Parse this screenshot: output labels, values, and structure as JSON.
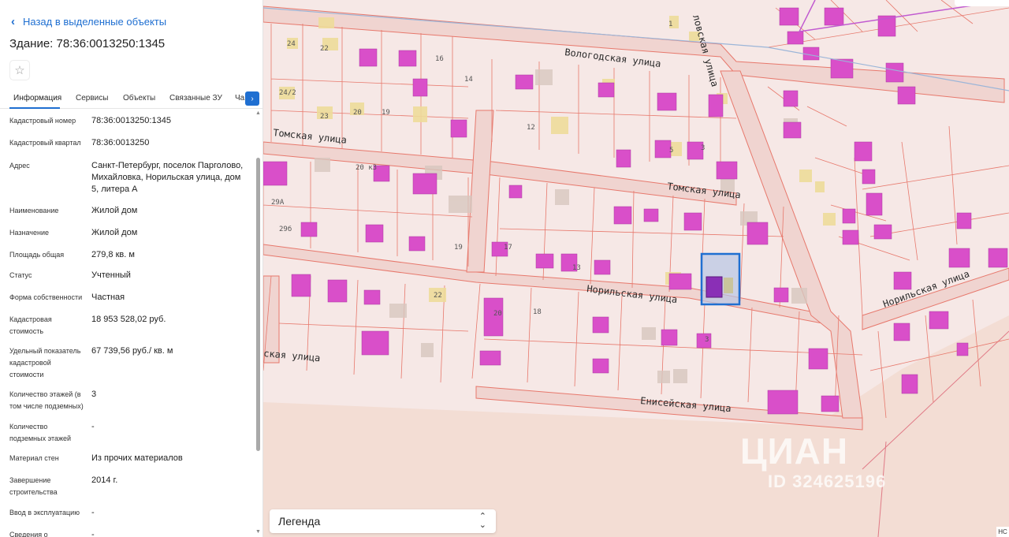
{
  "panel": {
    "back_label": "Назад в выделенные объекты",
    "title": "Здание: 78:36:0013250:1345",
    "tabs": [
      "Информация",
      "Сервисы",
      "Объекты",
      "Связанные ЗУ",
      "Ча"
    ],
    "properties": [
      {
        "label": "Кадастровый номер",
        "value": "78:36:0013250:1345"
      },
      {
        "label": "Кадастровый квартал",
        "value": "78:36:0013250"
      },
      {
        "label": "Адрес",
        "value": "Санкт-Петербург, поселок Парголово, Михайловка, Норильская улица, дом 5, литера А"
      },
      {
        "label": "Наименование",
        "value": "Жилой дом"
      },
      {
        "label": "Назначение",
        "value": "Жилой дом"
      },
      {
        "label": "Площадь общая",
        "value": "279,8 кв. м"
      },
      {
        "label": "Статус",
        "value": "Учтенный"
      },
      {
        "label": "Форма собственности",
        "value": "Частная"
      },
      {
        "label": "Кадастровая стоимость",
        "value": "18 953 528,02 руб."
      },
      {
        "label": "Удельный показатель кадастровой стоимости",
        "value": "67 739,56 руб./ кв. м"
      },
      {
        "label": "Количество этажей (в том числе подземных)",
        "value": "3"
      },
      {
        "label": "Количество подземных этажей",
        "value": "-"
      },
      {
        "label": "Материал стен",
        "value": "Из прочих материалов"
      },
      {
        "label": "Завершение строительства",
        "value": "2014 г."
      },
      {
        "label": "Ввод в эксплуатацию",
        "value": "-"
      },
      {
        "label": "Сведения о включении",
        "value": "-"
      }
    ]
  },
  "map": {
    "streets": [
      "Вологодская улица",
      "Томская улица",
      "Томская улица",
      "Норильская улица",
      "Норильская улица",
      "Енисейская улица",
      "ская улица",
      "ловская улица"
    ],
    "lot_numbers": [
      "24",
      "22",
      "16",
      "14",
      "24/2",
      "23",
      "20",
      "19",
      "12",
      "5",
      "3",
      "1",
      "20 к3",
      "29А",
      "29б",
      "19",
      "17",
      "13",
      "22",
      "20",
      "18",
      "3"
    ],
    "legend_label": "Легенда",
    "watermark": "ЦИАН",
    "watermark_id": "ID 324625196",
    "corner_tag": "НС",
    "colors": {
      "building": "#d94fc9",
      "parcel_line": "#e7786c",
      "road": "#f0d4d0",
      "selected": "#1f6fd1",
      "land": "#f6e8e6",
      "field": "#f3ddd4"
    }
  }
}
